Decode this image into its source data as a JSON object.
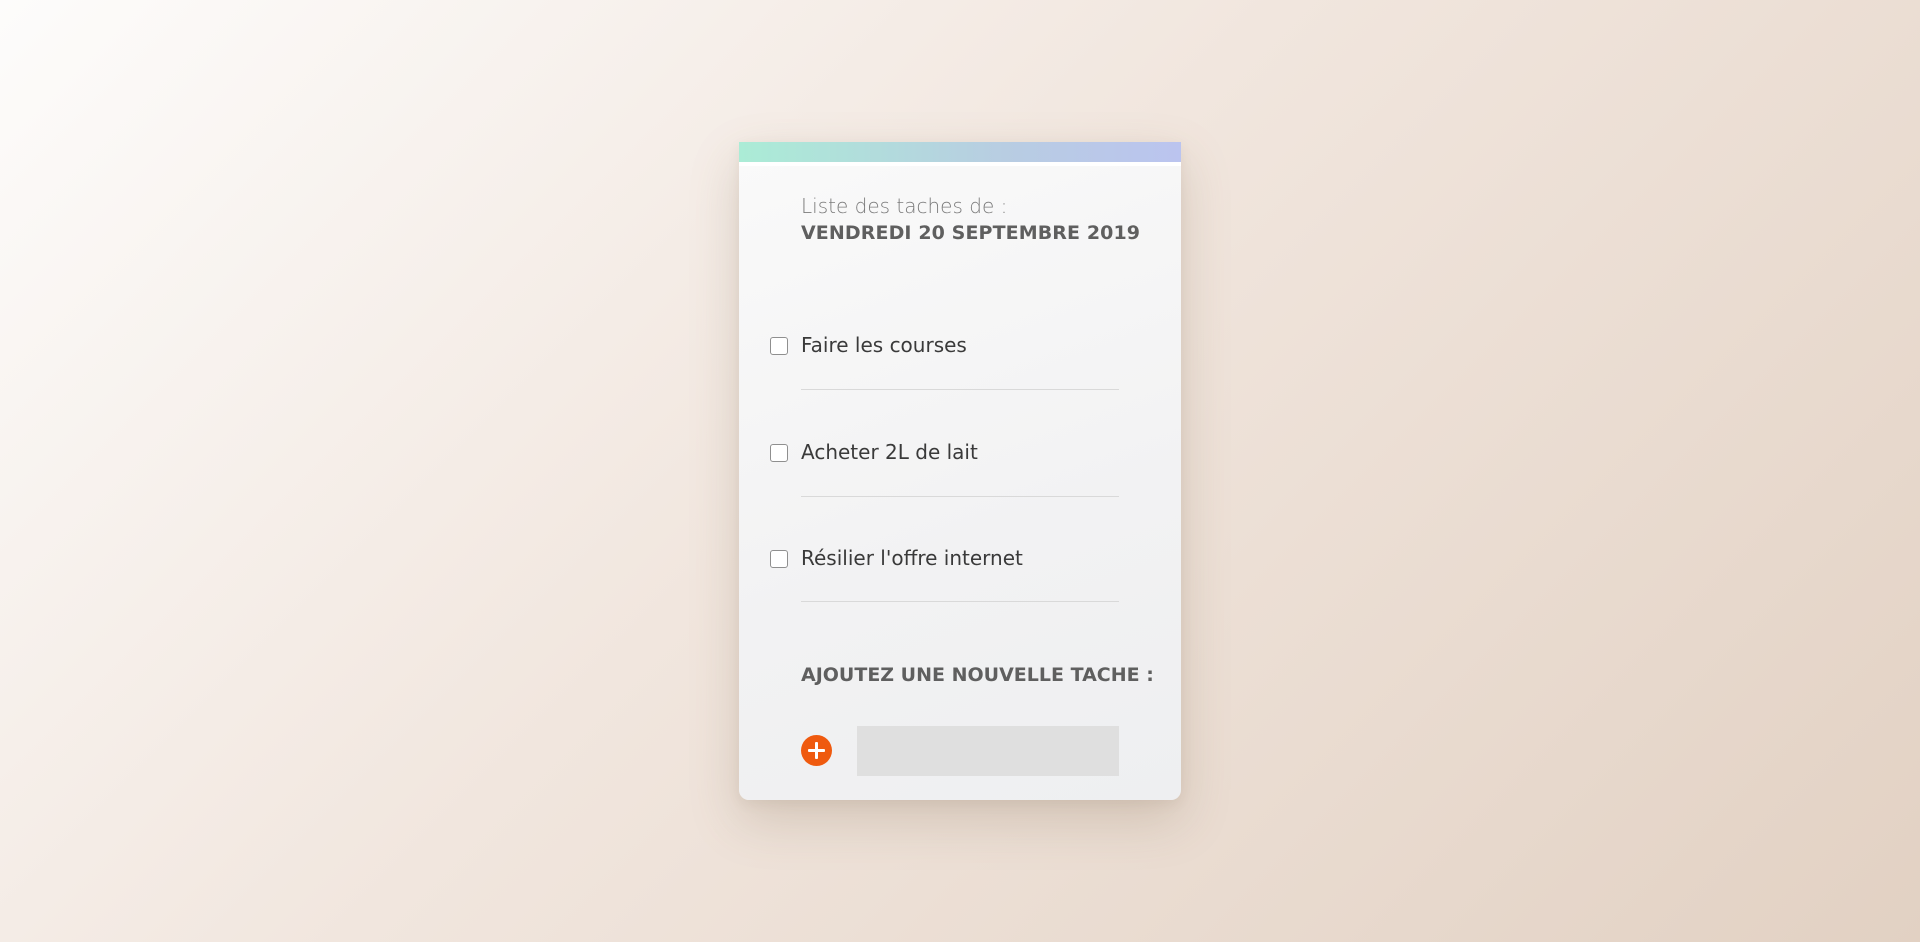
{
  "header": {
    "label": "Liste des taches de :",
    "date": "VENDREDI 20 SEPTEMBRE 2019"
  },
  "tasks": [
    {
      "label": "Faire les courses",
      "checked": false
    },
    {
      "label": "Acheter 2L de lait",
      "checked": false
    },
    {
      "label": "Résilier l'offre internet",
      "checked": false
    }
  ],
  "add_section": {
    "title": "AJOUTEZ UNE NOUVELLE TACHE :",
    "input_value": "",
    "button_icon": "plus-circle-icon"
  },
  "colors": {
    "accent": "#ef5a0f",
    "topbar_start": "#abecd6",
    "topbar_end": "#bbc4ef"
  }
}
